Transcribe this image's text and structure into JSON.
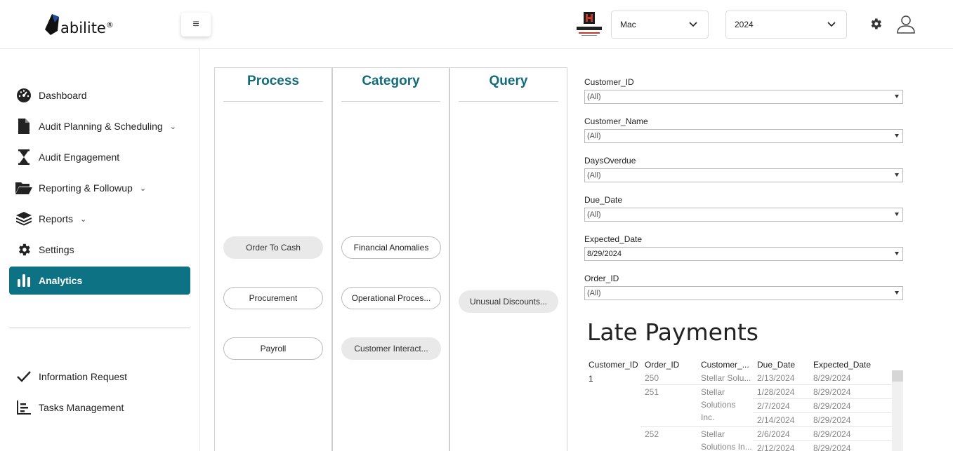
{
  "header": {
    "logo_text": "abilite",
    "logo_mark": "®",
    "entity_select": "Mac",
    "year_select": "2024"
  },
  "sidebar": {
    "items": [
      {
        "label": "Dashboard",
        "icon": "dashboard-icon"
      },
      {
        "label": "Audit Planning & Scheduling",
        "icon": "file-icon"
      },
      {
        "label": "Audit Engagement",
        "icon": "hourglass-icon"
      },
      {
        "label": "Reporting & Followup",
        "icon": "folder-open-icon"
      },
      {
        "label": "Reports",
        "icon": "layers-icon"
      },
      {
        "label": "Settings",
        "icon": "gear-icon"
      },
      {
        "label": "Analytics",
        "icon": "bar-chart-icon"
      }
    ],
    "bottom_items": [
      {
        "label": "Information Request",
        "icon": "check-icon"
      },
      {
        "label": "Tasks Management",
        "icon": "tasks-chart-icon"
      }
    ],
    "accent_color": "#0e7285"
  },
  "columns": {
    "process": {
      "title": "Process",
      "items": [
        "Order To Cash",
        "Procurement",
        "Payroll"
      ]
    },
    "category": {
      "title": "Category",
      "items": [
        "Financial Anomalies",
        "Operational Proces...",
        "Customer Interact..."
      ]
    },
    "query": {
      "title": "Query",
      "items": [
        "Unusual Discounts..."
      ]
    }
  },
  "filters": [
    {
      "label": "Customer_ID",
      "value": "(All)"
    },
    {
      "label": "Customer_Name",
      "value": "(All)"
    },
    {
      "label": "DaysOverdue",
      "value": "(All)"
    },
    {
      "label": "Due_Date",
      "value": "(All)"
    },
    {
      "label": "Expected_Date",
      "value": "8/29/2024"
    },
    {
      "label": "Order_ID",
      "value": "(All)"
    }
  ],
  "report": {
    "title": "Late Payments",
    "columns": [
      "Customer_ID",
      "Order_ID",
      "Customer_...",
      "Due_Date",
      "Expected_Date"
    ],
    "customer_id": "1",
    "orders": [
      {
        "order_id": "250",
        "customer": [
          "Stellar Solu..."
        ],
        "rows": [
          [
            "2/13/2024",
            "8/29/2024"
          ]
        ]
      },
      {
        "order_id": "251",
        "customer": [
          "Stellar",
          "Solutions",
          "Inc."
        ],
        "rows": [
          [
            "1/28/2024",
            "8/29/2024"
          ],
          [
            "2/7/2024",
            "8/29/2024"
          ],
          [
            "2/14/2024",
            "8/29/2024"
          ]
        ]
      },
      {
        "order_id": "252",
        "customer": [
          "Stellar",
          "Solutions In..."
        ],
        "rows": [
          [
            "2/6/2024",
            "8/29/2024"
          ],
          [
            "2/12/2024",
            "8/29/2024"
          ]
        ]
      }
    ]
  }
}
